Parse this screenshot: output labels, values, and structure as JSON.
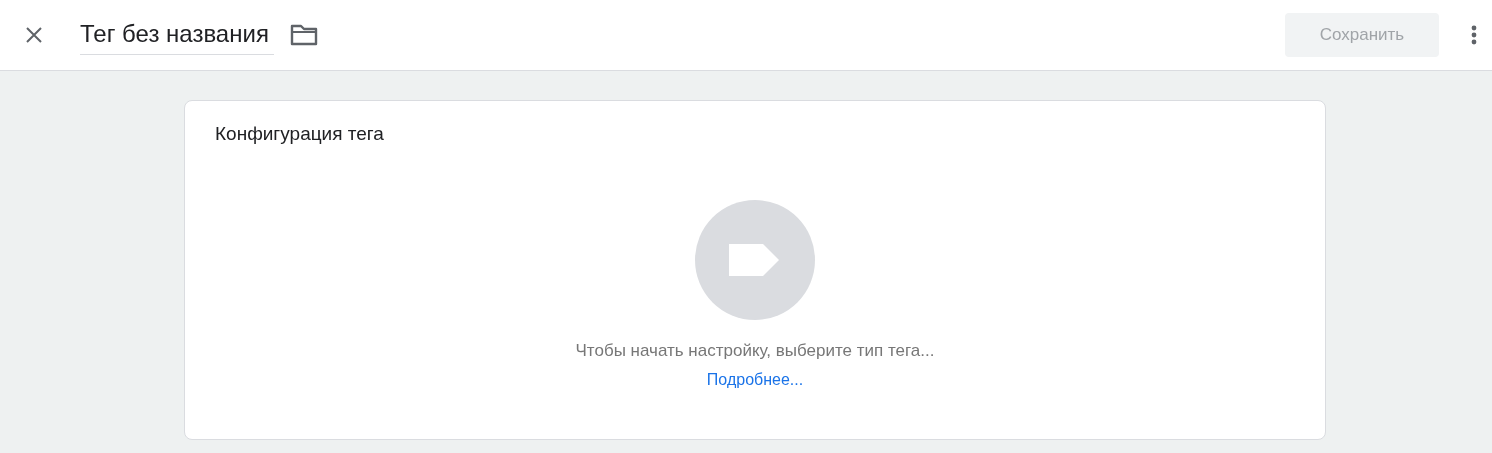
{
  "header": {
    "title": "Тег без названия",
    "save_button": {
      "label": "Сохранить",
      "disabled": true
    }
  },
  "card": {
    "title": "Конфигурация тега",
    "hint": "Чтобы начать настройку, выберите тип тега...",
    "link": "Подробнее..."
  }
}
